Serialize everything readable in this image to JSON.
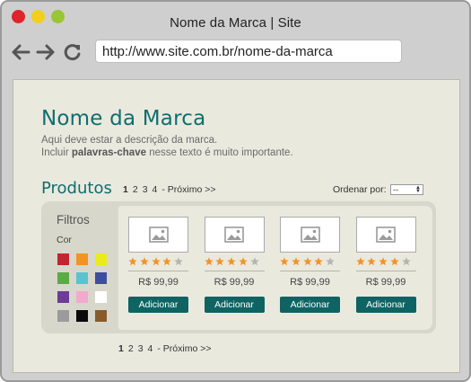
{
  "browser": {
    "title": "Nome da Marca | Site",
    "url": "http://www.site.com.br/nome-da-marca"
  },
  "brand": {
    "name": "Nome da Marca",
    "description_line1": "Aqui deve estar a descrição da marca.",
    "description_line2_prefix": "Incluir ",
    "description_line2_bold": "palavras-chave",
    "description_line2_suffix": " nesse texto é muito importante."
  },
  "products": {
    "title": "Produtos",
    "pager": {
      "pages": [
        "1",
        "2",
        "3",
        "4"
      ],
      "current": "1",
      "next_label": "- Próximo >>"
    },
    "sort": {
      "label": "Ordenar por:",
      "value": "--"
    }
  },
  "filters": {
    "title": "Filtros",
    "color_label": "Cor",
    "colors": [
      "#c0262d",
      "#f39325",
      "#eaec1a",
      "#5aaa45",
      "#5bc3d0",
      "#3b4ea0",
      "#6d3c96",
      "#f3a8cd",
      "#ffffff",
      "#9b9b9b",
      "#0b0b0b",
      "#8a5a2b"
    ]
  },
  "items": [
    {
      "price": "R$ 99,99",
      "button": "Adicionar",
      "rating": 4,
      "rating_max": 5
    },
    {
      "price": "R$ 99,99",
      "button": "Adicionar",
      "rating": 4,
      "rating_max": 5
    },
    {
      "price": "R$ 99,99",
      "button": "Adicionar",
      "rating": 4,
      "rating_max": 5
    },
    {
      "price": "R$ 99,99",
      "button": "Adicionar",
      "rating": 4,
      "rating_max": 5
    }
  ],
  "colors": {
    "accent": "#0f6e6f",
    "button": "#0f6363",
    "star_filled": "#f39325",
    "star_empty": "#b4b4b4"
  },
  "icons": {
    "back": "arrow-left-icon",
    "forward": "arrow-right-icon",
    "reload": "reload-icon",
    "product_image": "image-placeholder-icon",
    "star": "star-icon"
  }
}
